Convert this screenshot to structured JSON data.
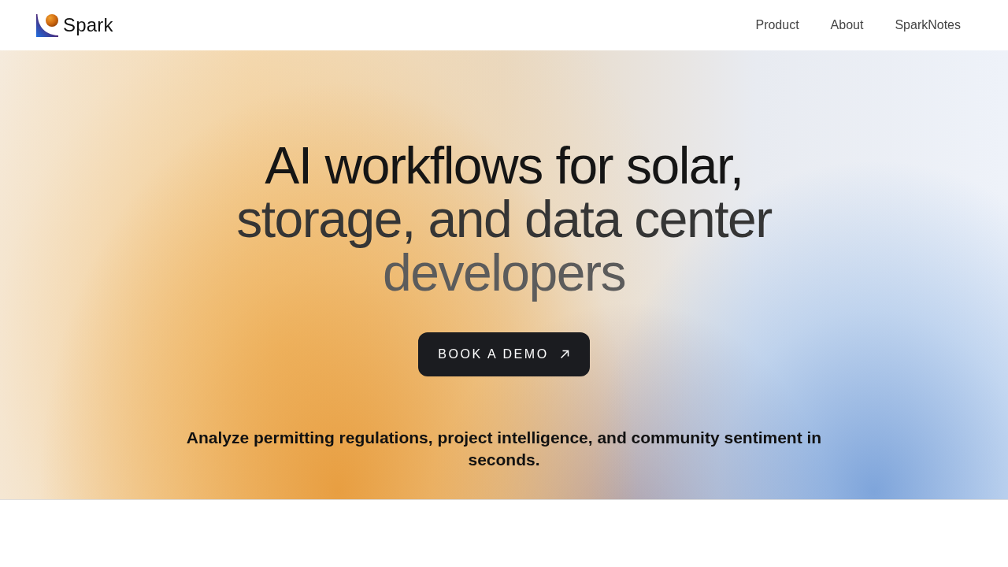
{
  "header": {
    "logo": {
      "name": "Spark"
    },
    "nav": [
      "Product",
      "About",
      "SparkNotes"
    ]
  },
  "hero": {
    "headline": [
      "AI workflows for solar,",
      "storage, and data center",
      "developers"
    ],
    "cta": {
      "label": "BOOK A DEMO"
    },
    "subtitle": "Analyze permitting regulations, project intelligence, and community sentiment in seconds."
  }
}
